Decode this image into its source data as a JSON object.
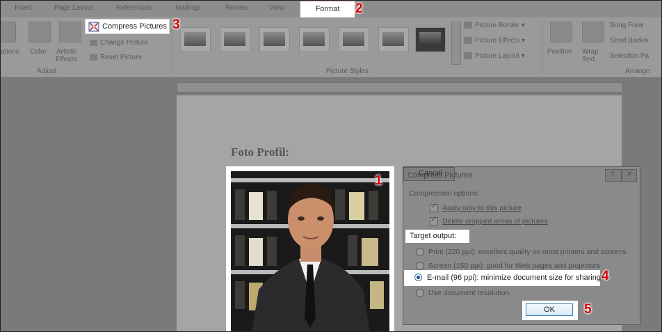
{
  "ribbon": {
    "tabs": [
      "Insert",
      "Page Layout",
      "References",
      "Mailings",
      "Review",
      "View"
    ],
    "active_tab": "Format",
    "adjust_group": {
      "items": [
        "ations",
        "Color",
        "Artistic",
        "Effects"
      ],
      "compress_pictures": "Compress Pictures",
      "change_picture": "Change Picture",
      "reset_picture": "Reset Picture",
      "label": "Adjust"
    },
    "picture_styles": {
      "label": "Picture Styles",
      "border": "Picture Border",
      "effects": "Picture Effects",
      "layout": "Picture Layout"
    },
    "arrange": {
      "position": "Position",
      "wrap_text_1": "Wrap",
      "wrap_text_2": "Text",
      "bring_forward": "Bring Forw",
      "send_backward": "Send Backw",
      "selection_pane": "Selection Pa",
      "label": "Arrange"
    }
  },
  "document": {
    "heading": "Foto Profil:"
  },
  "dialog": {
    "title": "Compress Pictures",
    "compression_options": "Compression options:",
    "apply_only": "Apply only to this picture",
    "delete_cropped": "Delete cropped areas of pictures",
    "target_output": "Target output:",
    "print": "Print (220 ppi): excellent quality on most printers and screens",
    "screen": "Screen (150 ppi): good for Web pages and projectors",
    "email": "E-mail (96 ppi): minimize document size for sharing",
    "use_doc_res": "Use document resolution",
    "ok": "OK",
    "cancel": "Cancel"
  },
  "badges": {
    "b1": "1",
    "b2": "2",
    "b3": "3",
    "b4": "4",
    "b5": "5"
  },
  "colors": {
    "badge": "#d40000",
    "ok_border": "#3c7fb1"
  }
}
